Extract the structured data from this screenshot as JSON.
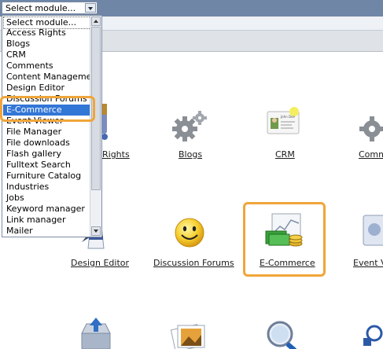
{
  "select": {
    "value": "Select module..."
  },
  "dropdown": {
    "items": [
      "Select module...",
      "Access Rights",
      "Blogs",
      "CRM",
      "Comments",
      "Content Management",
      "Design Editor",
      "Discussion Forums",
      "E-Commerce",
      "Event Viewer",
      "File Manager",
      "File downloads",
      "Flash gallery",
      "Fulltext Search",
      "Furniture Catalog",
      "Industries",
      "Jobs",
      "Keyword manager",
      "Link manager",
      "Mailer"
    ],
    "selected": "E-Commerce"
  },
  "modules": {
    "row1": [
      "Rights",
      "Blogs",
      "CRM",
      "Comm"
    ],
    "row2": [
      "Design Editor",
      "Discussion Forums",
      "E-Commerce",
      "Event V"
    ]
  },
  "crm_card_text": "John Doe",
  "colors": {
    "highlight": "#f0a53a",
    "selection": "#3276d6",
    "topbar": "#6f86a7"
  },
  "icons": [
    "gear-icon",
    "contact-card-icon",
    "lighthouse-icon",
    "smiley-icon",
    "cash-chart-icon",
    "magnifier-icon",
    "photo-icon",
    "inbox-icon"
  ]
}
